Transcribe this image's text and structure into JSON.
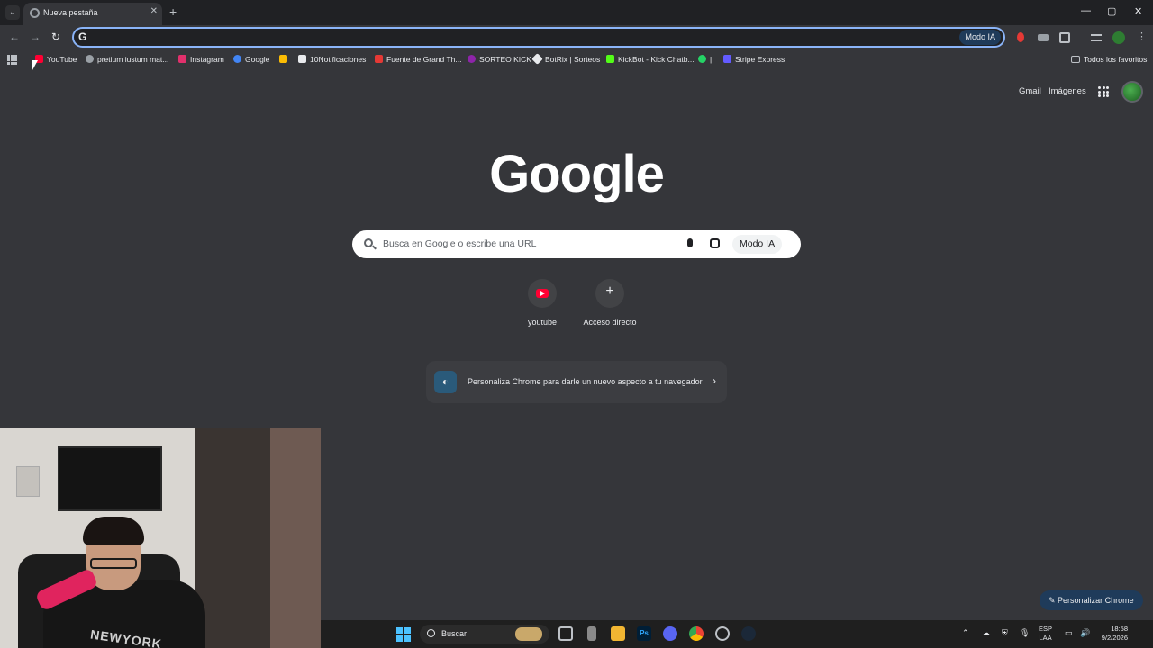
{
  "tab": {
    "title": "Nueva pestaña"
  },
  "window_controls": [
    "—",
    "▢",
    "✕"
  ],
  "omnibox": {
    "value": "",
    "modo_ia": "Modo IA"
  },
  "bookmarks": [
    {
      "label": "YouTube",
      "color": "#ff0033"
    },
    {
      "label": "pretium iustum mat...",
      "color": "#9aa0a6"
    },
    {
      "label": "Instagram",
      "color": "#e1306c"
    },
    {
      "label": "Google",
      "color": "#4285f4"
    },
    {
      "label": "",
      "color": "#fbbc04"
    },
    {
      "label": "10Notificaciones",
      "color": "#e8eaed"
    },
    {
      "label": "Fuente de Grand Th...",
      "color": "#e53935"
    },
    {
      "label": "SORTEO KICK",
      "color": "#8e24aa"
    },
    {
      "label": "BotRix | Sorteos",
      "color": "#e8eaed"
    },
    {
      "label": "KickBot - Kick Chatb...",
      "color": "#53fc18"
    },
    {
      "label": "|",
      "color": "#25d366"
    },
    {
      "label": "Stripe Express",
      "color": "#635bff"
    }
  ],
  "favorites_folder": "Todos los favoritos",
  "header_links": {
    "gmail": "Gmail",
    "images": "Imágenes"
  },
  "logo": "Google",
  "search": {
    "placeholder": "Busca en Google o escribe una URL",
    "modo_ia": "Modo IA"
  },
  "shortcuts": [
    {
      "label": "youtube",
      "icon": "youtube-icon"
    },
    {
      "label": "Acceso directo",
      "icon": "plus-icon"
    }
  ],
  "banner": {
    "text": "Personaliza Chrome para darle un nuevo aspecto a tu navegador"
  },
  "customize_button": "Personalizar Chrome",
  "webcam": {
    "hoodie_text": "NEWYORK"
  },
  "taskbar": {
    "search_label": "Buscar",
    "ps_label": "Ps",
    "lang_top": "ESP",
    "lang_bottom": "LAA",
    "time": "18:58",
    "date": "9/2/2026"
  }
}
